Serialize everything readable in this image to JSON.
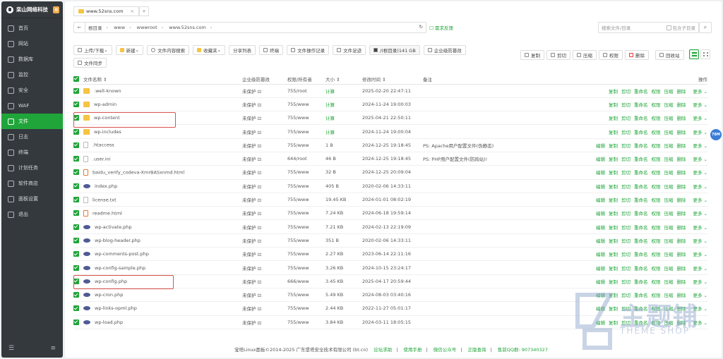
{
  "brand": {
    "name": "栾山网络科技",
    "badge": "0"
  },
  "nav": [
    {
      "label": "首页",
      "icon": "home-icon"
    },
    {
      "label": "网站",
      "icon": "globe-icon"
    },
    {
      "label": "数据库",
      "icon": "database-icon"
    },
    {
      "label": "监控",
      "icon": "monitor-icon"
    },
    {
      "label": "安全",
      "icon": "shield-icon"
    },
    {
      "label": "WAF",
      "icon": "waf-icon"
    },
    {
      "label": "文件",
      "icon": "folder-icon",
      "active": true
    },
    {
      "label": "日志",
      "icon": "log-icon"
    },
    {
      "label": "终端",
      "icon": "terminal-icon"
    },
    {
      "label": "计划任务",
      "icon": "clock-icon"
    },
    {
      "label": "软件商店",
      "icon": "store-icon"
    },
    {
      "label": "面板设置",
      "icon": "settings-icon"
    },
    {
      "label": "退出",
      "icon": "logout-icon"
    }
  ],
  "tab": {
    "label": "www.52sns.com"
  },
  "path": {
    "items": [
      "根目录",
      "www",
      "wwwroot",
      "www.52sns.com"
    ]
  },
  "feedback": "需求反馈",
  "search": {
    "placeholder": "搜索文件/目录",
    "sub_label": "包含子目录"
  },
  "toolbar": {
    "upload": "上传/下载",
    "new": "新建",
    "content_search": "文件内容搜索",
    "favorites": "收藏夹",
    "share_list": "分享列表",
    "terminal": "终端",
    "op_log": "文件操作记录",
    "footprint": "文件足迹",
    "disk": "/(根目录)141 GB",
    "defense": "企业级防篡改",
    "sync": "文件同步"
  },
  "rtools": {
    "copy": "复制",
    "cut": "剪切",
    "compress": "压缩",
    "perm": "权限",
    "delete": "删除",
    "recycle": "回收站"
  },
  "columns": {
    "name": "文件名称",
    "protect": "企业级防篡改",
    "perm": "权限/所有者",
    "size": "大小",
    "mtime": "修改时间",
    "note": "备注",
    "actions": "操作"
  },
  "row_actions": {
    "edit": "编辑",
    "copy": "复制",
    "cut": "剪切",
    "rename": "重命名",
    "perm": "权限",
    "compress": "压缩",
    "delete": "删除",
    "more": "更多"
  },
  "files": [
    {
      "name": ".well-known",
      "type": "folder",
      "protect": "未保护",
      "perm": "755/root",
      "size": "计算",
      "mtime": "2025-02-20 22:47:11",
      "note": ""
    },
    {
      "name": "wp-admin",
      "type": "folder",
      "protect": "未保护",
      "perm": "755/www",
      "size": "计算",
      "mtime": "2024-11-24 19:00:03",
      "note": ""
    },
    {
      "name": "wp-content",
      "type": "folder",
      "protect": "未保护",
      "perm": "755/www",
      "size": "计算",
      "mtime": "2025-04-21 22:50:11",
      "note": ""
    },
    {
      "name": "wp-includes",
      "type": "folder",
      "protect": "未保护",
      "perm": "755/www",
      "size": "计算",
      "mtime": "2024-11-24 19:00:04",
      "note": ""
    },
    {
      "name": ".htaccess",
      "type": "text",
      "protect": "未保护",
      "perm": "755/www",
      "size": "1 B",
      "mtime": "2024-12-25 19:18:45",
      "note": "PS: Apache用户配置文件(伪静态)"
    },
    {
      "name": ".user.ini",
      "type": "text",
      "protect": "未保护",
      "perm": "644/root",
      "size": "46 B",
      "mtime": "2024-12-25 19:18:45",
      "note": "PS: PHP用户配置文件(防跨站)!"
    },
    {
      "name": "baidu_verify_codeva-XmrBASxnmd.html",
      "type": "html",
      "protect": "未保护",
      "perm": "755/www",
      "size": "32 B",
      "mtime": "2024-12-25 20:09:04",
      "note": ""
    },
    {
      "name": "index.php",
      "type": "php",
      "protect": "未保护",
      "perm": "755/www",
      "size": "405 B",
      "mtime": "2020-02-06 14:33:11",
      "note": ""
    },
    {
      "name": "license.txt",
      "type": "text",
      "protect": "未保护",
      "perm": "755/www",
      "size": "19.45 KB",
      "mtime": "2024-01-01 08:02:19",
      "note": ""
    },
    {
      "name": "readme.html",
      "type": "html",
      "protect": "未保护",
      "perm": "755/www",
      "size": "7.24 KB",
      "mtime": "2024-06-18 19:59:14",
      "note": ""
    },
    {
      "name": "wp-activate.php",
      "type": "php",
      "protect": "未保护",
      "perm": "755/www",
      "size": "7.21 KB",
      "mtime": "2024-02-13 22:19:09",
      "note": ""
    },
    {
      "name": "wp-blog-header.php",
      "type": "php",
      "protect": "未保护",
      "perm": "755/www",
      "size": "351 B",
      "mtime": "2020-02-06 14:33:11",
      "note": ""
    },
    {
      "name": "wp-comments-post.php",
      "type": "php",
      "protect": "未保护",
      "perm": "755/www",
      "size": "2.27 KB",
      "mtime": "2023-06-14 22:11:16",
      "note": ""
    },
    {
      "name": "wp-config-sample.php",
      "type": "php",
      "protect": "未保护",
      "perm": "755/www",
      "size": "3.26 KB",
      "mtime": "2024-10-15 23:24:17",
      "note": ""
    },
    {
      "name": "wp-config.php",
      "type": "php",
      "protect": "未保护",
      "perm": "666/www",
      "size": "3.45 KB",
      "mtime": "2025-04-17 20:59:44",
      "note": ""
    },
    {
      "name": "wp-cron.php",
      "type": "php",
      "protect": "未保护",
      "perm": "755/www",
      "size": "5.49 KB",
      "mtime": "2024-08-03 03:40:16",
      "note": ""
    },
    {
      "name": "wp-links-opml.php",
      "type": "php",
      "protect": "未保护",
      "perm": "755/www",
      "size": "2.44 KB",
      "mtime": "2022-11-27 05:01:17",
      "note": ""
    },
    {
      "name": "wp-load.php",
      "type": "php",
      "protect": "未保护",
      "perm": "755/www",
      "size": "3.84 KB",
      "mtime": "2024-03-11 18:05:15",
      "note": ""
    }
  ],
  "footer": {
    "copyright": "宝塔Linux面板©2014-2025 广东堡塔安全技术有限公司 (bt.cn)",
    "forum": "论坛求助",
    "manual": "使用手册",
    "wechat": "微信公众号",
    "verify": "正版查询",
    "qq": "售前QQ群: 907340327"
  },
  "badge_float": "78M",
  "watermark": {
    "big": "主题铺",
    "small": "THEME SHOP"
  },
  "colors": {
    "accent": "#20a53a",
    "highlight": "#d9534f"
  }
}
